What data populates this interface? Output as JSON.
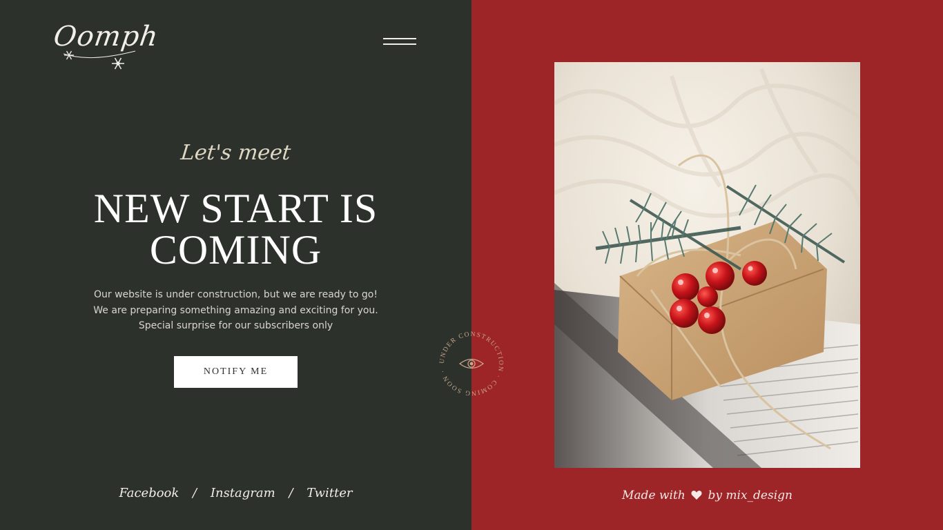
{
  "brand": {
    "logo_text": "Oomph"
  },
  "hero": {
    "tagline": "Let's meet",
    "headline_line1": "NEW START IS",
    "headline_line2": "COMING",
    "description_lines": [
      "Our website is under construction, but we are ready to go!",
      "We are preparing something amazing and exciting for you.",
      "Special surprise for our subscribers only"
    ],
    "cta_label": "NOTIFY ME"
  },
  "badge": {
    "text": "UNDER CONSTRUCTION · COMING SOON ·"
  },
  "social": {
    "links": [
      "Facebook",
      "Instagram",
      "Twitter"
    ],
    "separator": "/"
  },
  "footer": {
    "made_with": "Made with",
    "by": "by mix_design"
  },
  "colors": {
    "left_bg": "#2d312c",
    "right_bg": "#9d2427",
    "accent_cream": "#ded7c3",
    "badge_tan": "#c9a68b"
  },
  "icons": {
    "logo_snowflakes": "snowflake-icon",
    "menu": "hamburger-menu-icon",
    "badge": "eye-icon",
    "heart": "heart-icon"
  }
}
